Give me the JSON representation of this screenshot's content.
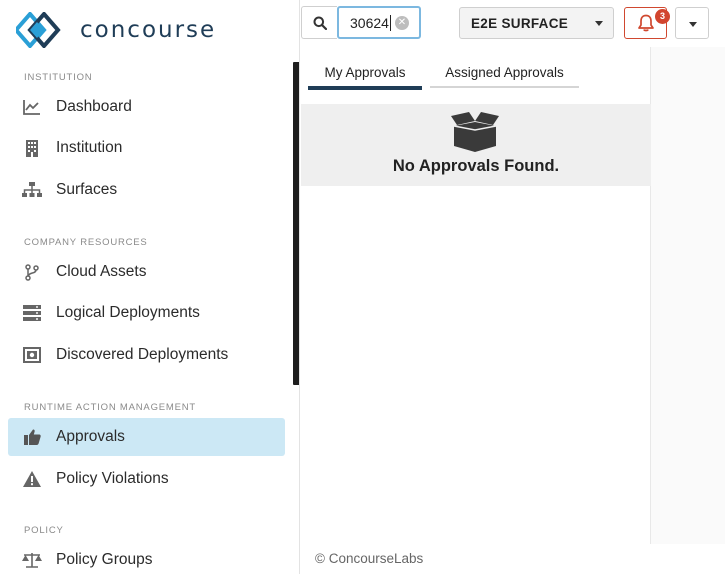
{
  "brand": {
    "name": "concourse"
  },
  "sidebar": {
    "sections": [
      {
        "title": "INSTITUTION"
      },
      {
        "title": "COMPANY RESOURCES"
      },
      {
        "title": "RUNTIME ACTION MANAGEMENT"
      },
      {
        "title": "POLICY"
      }
    ],
    "items": [
      {
        "label": "Dashboard",
        "icon": "chart-line-icon"
      },
      {
        "label": "Institution",
        "icon": "building-icon"
      },
      {
        "label": "Surfaces",
        "icon": "sitemap-icon"
      },
      {
        "label": "Cloud Assets",
        "icon": "code-branch-icon"
      },
      {
        "label": "Logical Deployments",
        "icon": "server-icon"
      },
      {
        "label": "Discovered Deployments",
        "icon": "scan-icon"
      },
      {
        "label": "Approvals",
        "icon": "thumbs-up-icon",
        "active": true
      },
      {
        "label": "Policy Violations",
        "icon": "warning-icon"
      },
      {
        "label": "Policy Groups",
        "icon": "balance-scale-icon"
      }
    ]
  },
  "topbar": {
    "search": {
      "value": "30624"
    },
    "surface": {
      "selected": "E2E SURFACE"
    },
    "notifications": {
      "count": "3"
    }
  },
  "approvals": {
    "tabs": [
      {
        "label": "My Approvals",
        "active": true
      },
      {
        "label": "Assigned Approvals",
        "active": false
      }
    ],
    "empty_message": "No Approvals Found."
  },
  "footer": {
    "text": "© ConcourseLabs"
  },
  "colors": {
    "brand": "#1f3d57",
    "accent": "#2a9fd6",
    "active_nav": "#cce8f5",
    "alert": "#d2452e"
  }
}
